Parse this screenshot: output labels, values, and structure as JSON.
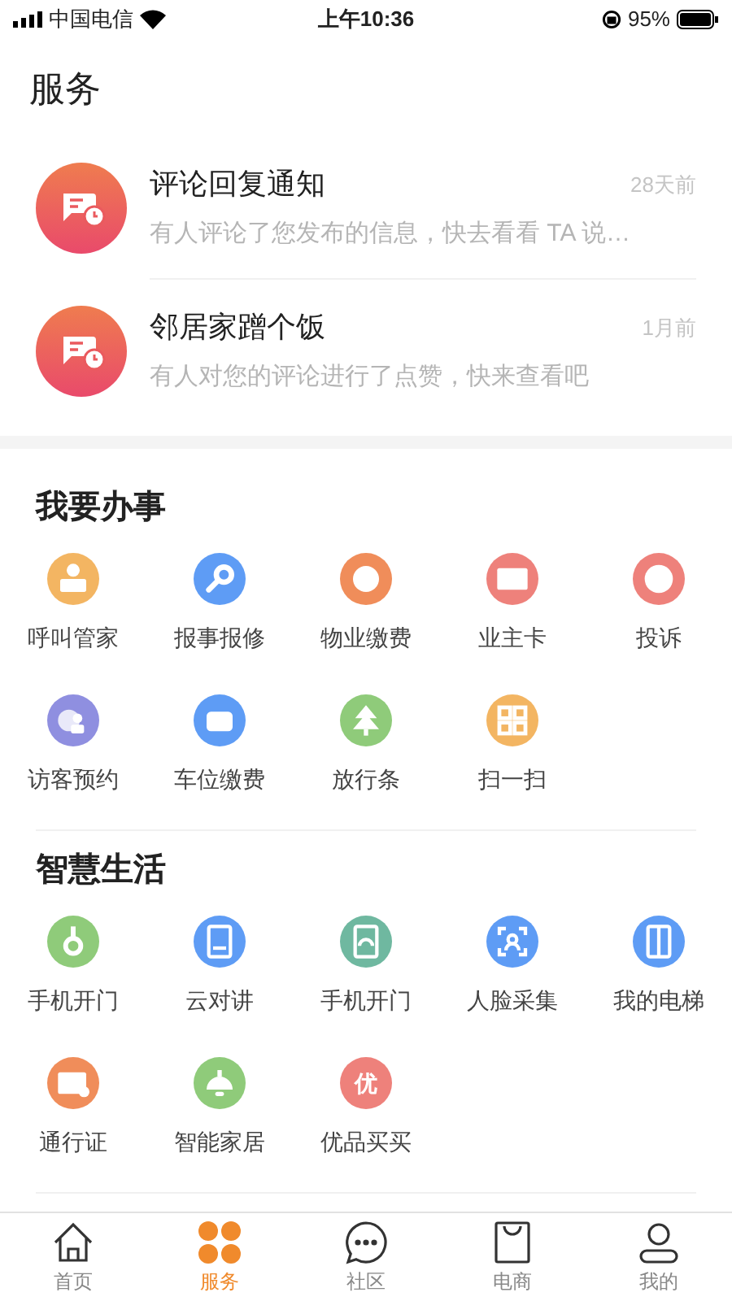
{
  "status_bar": {
    "carrier": "中国电信",
    "time": "上午10:36",
    "battery": "95%"
  },
  "title": "服务",
  "notifications": [
    {
      "title": "评论回复通知",
      "time": "28天前",
      "message": "有人评论了您发布的信息，快去看看 TA 说…"
    },
    {
      "title": "邻居家蹭个饭",
      "time": "1月前",
      "message": "有人对您的评论进行了点赞，快来查看吧"
    }
  ],
  "sections": [
    {
      "title": "我要办事",
      "items": [
        {
          "label": "呼叫管家",
          "color": "#f3b562"
        },
        {
          "label": "报事报修",
          "color": "#5e9cf5"
        },
        {
          "label": "物业缴费",
          "color": "#f08d5a"
        },
        {
          "label": "业主卡",
          "color": "#ee817b"
        },
        {
          "label": "投诉",
          "color": "#ee817b"
        },
        {
          "label": "访客预约",
          "color": "#8f8fe0"
        },
        {
          "label": "车位缴费",
          "color": "#5e9cf5"
        },
        {
          "label": "放行条",
          "color": "#8fcb7a"
        },
        {
          "label": "扫一扫",
          "color": "#f3b562"
        }
      ]
    },
    {
      "title": "智慧生活",
      "items": [
        {
          "label": "手机开门",
          "color": "#8fcb7a"
        },
        {
          "label": "云对讲",
          "color": "#5e9cf5"
        },
        {
          "label": "手机开门",
          "color": "#6fb8a0"
        },
        {
          "label": "人脸采集",
          "color": "#5e9cf5"
        },
        {
          "label": "我的电梯",
          "color": "#5e9cf5"
        },
        {
          "label": "通行证",
          "color": "#f08d5a"
        },
        {
          "label": "智能家居",
          "color": "#8fcb7a"
        },
        {
          "label": "优品买买",
          "color": "#ee817b",
          "icon_text": "优"
        }
      ]
    }
  ],
  "tabs": [
    {
      "label": "首页",
      "selected": false
    },
    {
      "label": "服务",
      "selected": true
    },
    {
      "label": "社区",
      "selected": false
    },
    {
      "label": "电商",
      "selected": false
    },
    {
      "label": "我的",
      "selected": false
    }
  ]
}
